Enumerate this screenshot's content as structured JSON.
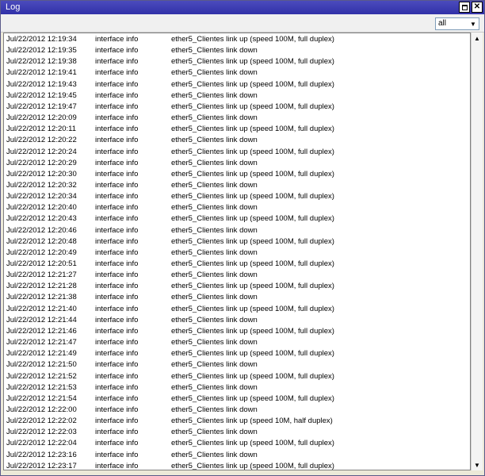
{
  "window": {
    "title": "Log"
  },
  "filter": {
    "value": "all"
  },
  "icons": {
    "maximize": "maximize-icon",
    "close": "close-icon",
    "dropdown": "chevron-down-icon",
    "scroll_up": "scroll-up-arrow-icon",
    "scroll_down": "scroll-down-arrow-icon"
  },
  "log_rows": [
    {
      "time": "Jul/22/2012 12:19:34",
      "topic": "interface info",
      "message": "ether5_Clientes link up (speed 100M, full duplex)"
    },
    {
      "time": "Jul/22/2012 12:19:35",
      "topic": "interface info",
      "message": "ether5_Clientes link down"
    },
    {
      "time": "Jul/22/2012 12:19:38",
      "topic": "interface info",
      "message": "ether5_Clientes link up (speed 100M, full duplex)"
    },
    {
      "time": "Jul/22/2012 12:19:41",
      "topic": "interface info",
      "message": "ether5_Clientes link down"
    },
    {
      "time": "Jul/22/2012 12:19:43",
      "topic": "interface info",
      "message": "ether5_Clientes link up (speed 100M, full duplex)"
    },
    {
      "time": "Jul/22/2012 12:19:45",
      "topic": "interface info",
      "message": "ether5_Clientes link down"
    },
    {
      "time": "Jul/22/2012 12:19:47",
      "topic": "interface info",
      "message": "ether5_Clientes link up (speed 100M, full duplex)"
    },
    {
      "time": "Jul/22/2012 12:20:09",
      "topic": "interface info",
      "message": "ether5_Clientes link down"
    },
    {
      "time": "Jul/22/2012 12:20:11",
      "topic": "interface info",
      "message": "ether5_Clientes link up (speed 100M, full duplex)"
    },
    {
      "time": "Jul/22/2012 12:20:22",
      "topic": "interface info",
      "message": "ether5_Clientes link down"
    },
    {
      "time": "Jul/22/2012 12:20:24",
      "topic": "interface info",
      "message": "ether5_Clientes link up (speed 100M, full duplex)"
    },
    {
      "time": "Jul/22/2012 12:20:29",
      "topic": "interface info",
      "message": "ether5_Clientes link down"
    },
    {
      "time": "Jul/22/2012 12:20:30",
      "topic": "interface info",
      "message": "ether5_Clientes link up (speed 100M, full duplex)"
    },
    {
      "time": "Jul/22/2012 12:20:32",
      "topic": "interface info",
      "message": "ether5_Clientes link down"
    },
    {
      "time": "Jul/22/2012 12:20:34",
      "topic": "interface info",
      "message": "ether5_Clientes link up (speed 100M, full duplex)"
    },
    {
      "time": "Jul/22/2012 12:20:40",
      "topic": "interface info",
      "message": "ether5_Clientes link down"
    },
    {
      "time": "Jul/22/2012 12:20:43",
      "topic": "interface info",
      "message": "ether5_Clientes link up (speed 100M, full duplex)"
    },
    {
      "time": "Jul/22/2012 12:20:46",
      "topic": "interface info",
      "message": "ether5_Clientes link down"
    },
    {
      "time": "Jul/22/2012 12:20:48",
      "topic": "interface info",
      "message": "ether5_Clientes link up (speed 100M, full duplex)"
    },
    {
      "time": "Jul/22/2012 12:20:49",
      "topic": "interface info",
      "message": "ether5_Clientes link down"
    },
    {
      "time": "Jul/22/2012 12:20:51",
      "topic": "interface info",
      "message": "ether5_Clientes link up (speed 100M, full duplex)"
    },
    {
      "time": "Jul/22/2012 12:21:27",
      "topic": "interface info",
      "message": "ether5_Clientes link down"
    },
    {
      "time": "Jul/22/2012 12:21:28",
      "topic": "interface info",
      "message": "ether5_Clientes link up (speed 100M, full duplex)"
    },
    {
      "time": "Jul/22/2012 12:21:38",
      "topic": "interface info",
      "message": "ether5_Clientes link down"
    },
    {
      "time": "Jul/22/2012 12:21:40",
      "topic": "interface info",
      "message": "ether5_Clientes link up (speed 100M, full duplex)"
    },
    {
      "time": "Jul/22/2012 12:21:44",
      "topic": "interface info",
      "message": "ether5_Clientes link down"
    },
    {
      "time": "Jul/22/2012 12:21:46",
      "topic": "interface info",
      "message": "ether5_Clientes link up (speed 100M, full duplex)"
    },
    {
      "time": "Jul/22/2012 12:21:47",
      "topic": "interface info",
      "message": "ether5_Clientes link down"
    },
    {
      "time": "Jul/22/2012 12:21:49",
      "topic": "interface info",
      "message": "ether5_Clientes link up (speed 100M, full duplex)"
    },
    {
      "time": "Jul/22/2012 12:21:50",
      "topic": "interface info",
      "message": "ether5_Clientes link down"
    },
    {
      "time": "Jul/22/2012 12:21:52",
      "topic": "interface info",
      "message": "ether5_Clientes link up (speed 100M, full duplex)"
    },
    {
      "time": "Jul/22/2012 12:21:53",
      "topic": "interface info",
      "message": "ether5_Clientes link down"
    },
    {
      "time": "Jul/22/2012 12:21:54",
      "topic": "interface info",
      "message": "ether5_Clientes link up (speed 100M, full duplex)"
    },
    {
      "time": "Jul/22/2012 12:22:00",
      "topic": "interface info",
      "message": "ether5_Clientes link down"
    },
    {
      "time": "Jul/22/2012 12:22:02",
      "topic": "interface info",
      "message": "ether5_Clientes link up (speed 10M, half duplex)"
    },
    {
      "time": "Jul/22/2012 12:22:03",
      "topic": "interface info",
      "message": "ether5_Clientes link down"
    },
    {
      "time": "Jul/22/2012 12:22:04",
      "topic": "interface info",
      "message": "ether5_Clientes link up (speed 100M, full duplex)"
    },
    {
      "time": "Jul/22/2012 12:23:16",
      "topic": "interface info",
      "message": "ether5_Clientes link down"
    },
    {
      "time": "Jul/22/2012 12:23:17",
      "topic": "interface info",
      "message": "ether5_Clientes link up (speed 100M, full duplex)"
    }
  ]
}
